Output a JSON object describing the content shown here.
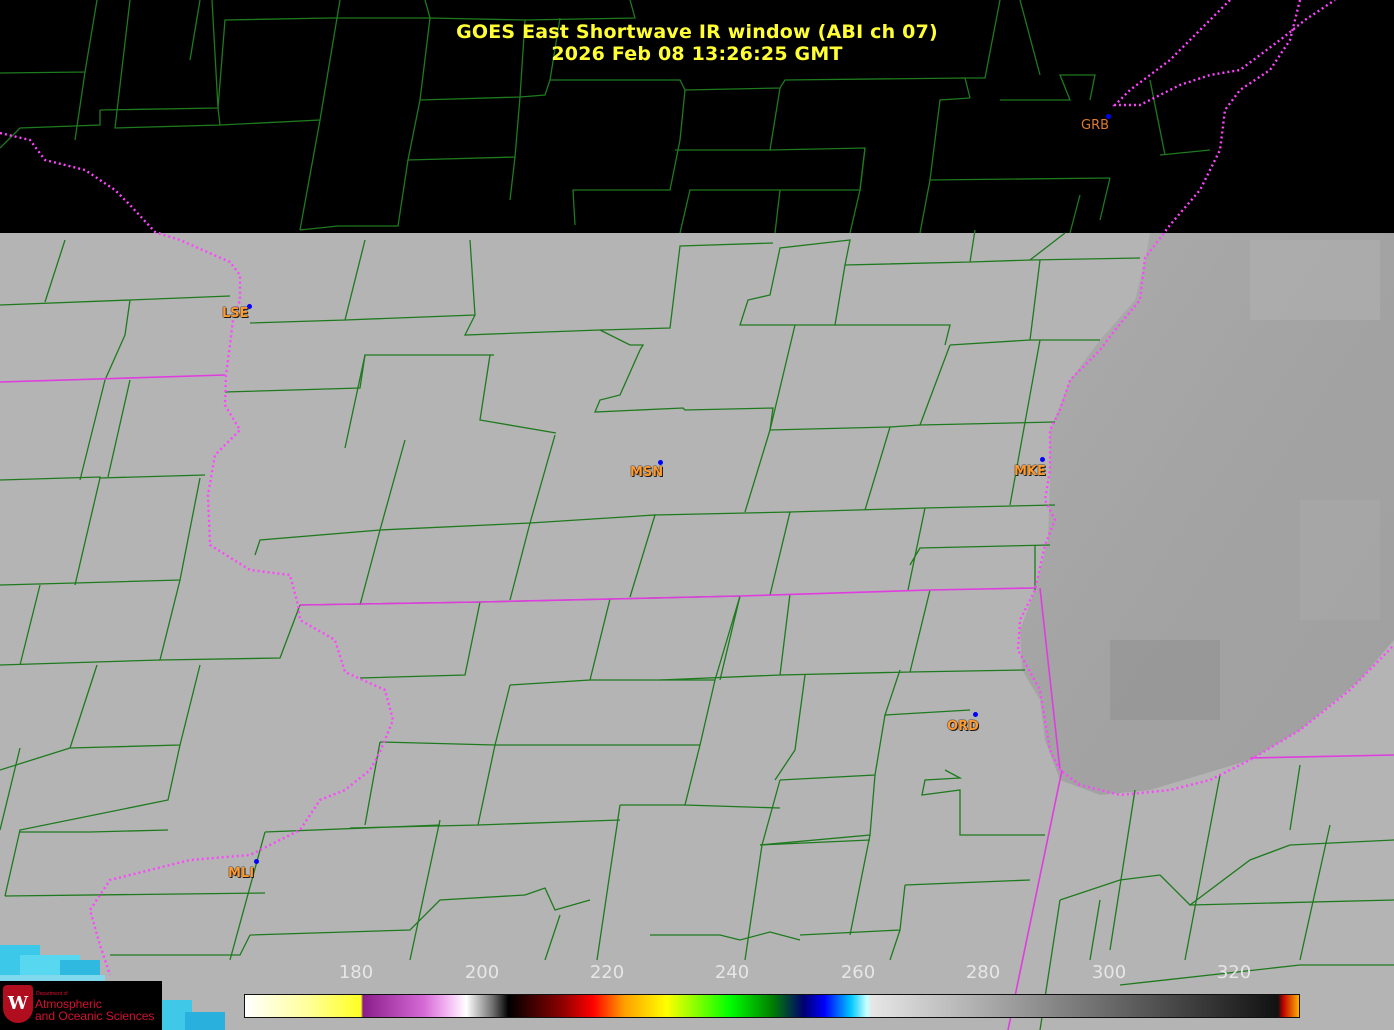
{
  "title": {
    "line1": "GOES East Shortwave IR window (ABI ch 07)",
    "line2": "2026 Feb 08  13:26:25 GMT"
  },
  "cities": {
    "grb": "GRB",
    "lse": "LSE",
    "msn": "MSN",
    "mke": "MKE",
    "ord": "ORD",
    "mli": "MLI"
  },
  "colorbar": {
    "ticks": [
      "180",
      "200",
      "220",
      "240",
      "260",
      "280",
      "300",
      "320"
    ]
  },
  "logo": {
    "dept": "Department of",
    "line1": "Atmospheric",
    "line2": "and Oceanic Sciences",
    "seal_letter": "W"
  },
  "colors": {
    "title": "#ffff33",
    "county_lines": "#1e7a1e",
    "state_lines": "#e03ce0",
    "city_labels": "#ff9a2e",
    "station_dots": "#0000ff"
  }
}
